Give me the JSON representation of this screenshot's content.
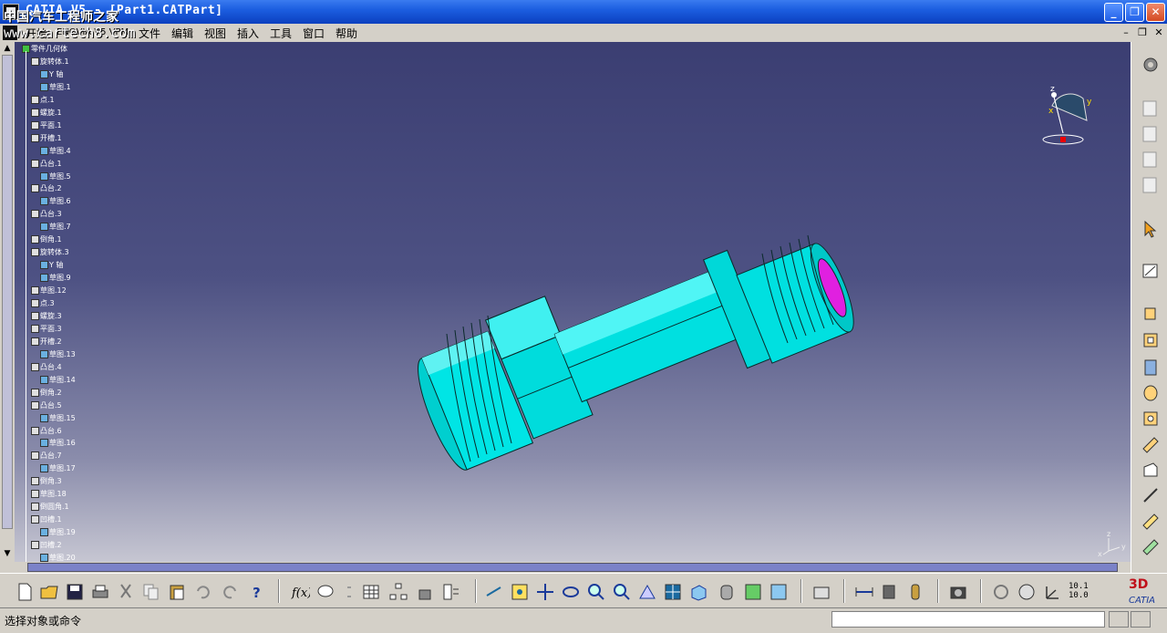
{
  "window": {
    "title": "CATIA V5 - [Part1.CATPart]",
    "minimize_label": "_",
    "restore_label": "❐",
    "close_label": "✕"
  },
  "watermark": {
    "line1": "中国汽车工程师之家",
    "line2": "www.cartech8.com"
  },
  "menubar": {
    "items": [
      "开始",
      "ENOVIA V5 VPM",
      "文件",
      "编辑",
      "视图",
      "插入",
      "工具",
      "窗口",
      "帮助"
    ],
    "mdi_minimize": "–",
    "mdi_restore": "❐",
    "mdi_close": "✕"
  },
  "tree": {
    "nodes": [
      {
        "label": "零件几何体",
        "depth": 0
      },
      {
        "label": "旋转体.1",
        "depth": 1
      },
      {
        "label": "Y 轴",
        "depth": 2
      },
      {
        "label": "草图.1",
        "depth": 2
      },
      {
        "label": "点.1",
        "depth": 1
      },
      {
        "label": "螺旋.1",
        "depth": 1
      },
      {
        "label": "平面.1",
        "depth": 1
      },
      {
        "label": "开槽.1",
        "depth": 1
      },
      {
        "label": "草图.4",
        "depth": 2
      },
      {
        "label": "凸台.1",
        "depth": 1
      },
      {
        "label": "草图.5",
        "depth": 2
      },
      {
        "label": "凸台.2",
        "depth": 1
      },
      {
        "label": "草图.6",
        "depth": 2
      },
      {
        "label": "凸台.3",
        "depth": 1
      },
      {
        "label": "草图.7",
        "depth": 2
      },
      {
        "label": "倒角.1",
        "depth": 1
      },
      {
        "label": "旋转体.3",
        "depth": 1
      },
      {
        "label": "Y 轴",
        "depth": 2
      },
      {
        "label": "草图.9",
        "depth": 2
      },
      {
        "label": "草图.12",
        "depth": 1
      },
      {
        "label": "点.3",
        "depth": 1
      },
      {
        "label": "螺旋.3",
        "depth": 1
      },
      {
        "label": "平面.3",
        "depth": 1
      },
      {
        "label": "开槽.2",
        "depth": 1
      },
      {
        "label": "草图.13",
        "depth": 2
      },
      {
        "label": "凸台.4",
        "depth": 1
      },
      {
        "label": "草图.14",
        "depth": 2
      },
      {
        "label": "倒角.2",
        "depth": 1
      },
      {
        "label": "凸台.5",
        "depth": 1
      },
      {
        "label": "草图.15",
        "depth": 2
      },
      {
        "label": "凸台.6",
        "depth": 1
      },
      {
        "label": "草图.16",
        "depth": 2
      },
      {
        "label": "凸台.7",
        "depth": 1
      },
      {
        "label": "草图.17",
        "depth": 2
      },
      {
        "label": "倒角.3",
        "depth": 1
      },
      {
        "label": "草图.18",
        "depth": 1
      },
      {
        "label": "倒圆角.1",
        "depth": 1
      },
      {
        "label": "凹槽.1",
        "depth": 1
      },
      {
        "label": "草图.19",
        "depth": 2
      },
      {
        "label": "凹槽.2",
        "depth": 1
      },
      {
        "label": "草图.20",
        "depth": 2
      }
    ]
  },
  "compass": {
    "x_label": "x",
    "y_label": "y",
    "z_label": "z"
  },
  "axis_triad": {
    "x_label": "x",
    "y_label": "y",
    "z_label": "z"
  },
  "statusbar": {
    "prompt": "选择对象或命令",
    "command_value": ""
  },
  "toolbar_bottom": {
    "zoom_text_top": "10.1",
    "zoom_text_bottom": "10.0"
  },
  "colors": {
    "part_body": "#00e5e5",
    "part_edge": "#0a2a2a",
    "bore": "#e020e0",
    "background_top": "#3b3e72",
    "background_bottom": "#c6c6d2"
  }
}
